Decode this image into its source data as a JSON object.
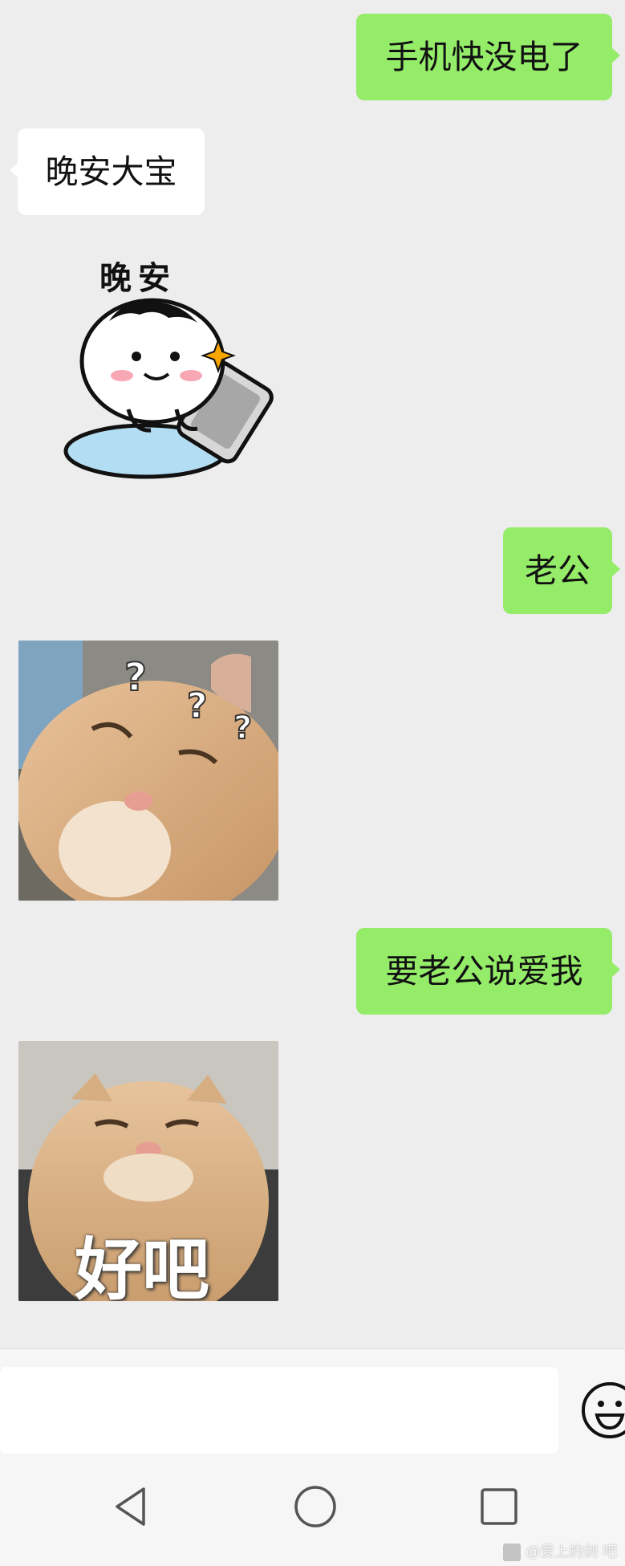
{
  "messages": [
    {
      "direction": "outgoing",
      "type": "text",
      "text": "手机快没电了"
    },
    {
      "direction": "incoming",
      "type": "text",
      "text": "晚安大宝"
    },
    {
      "direction": "incoming",
      "type": "sticker",
      "caption": "晚安"
    },
    {
      "direction": "outgoing",
      "type": "text",
      "text": "老公"
    },
    {
      "direction": "incoming",
      "type": "sticker",
      "caption": "???"
    },
    {
      "direction": "outgoing",
      "type": "text",
      "text": "要老公说爱我"
    },
    {
      "direction": "incoming",
      "type": "sticker",
      "caption": "好吧"
    }
  ],
  "input_bar": {
    "value": "",
    "emoji_icon": "emoji-smile-icon"
  },
  "nav_bar": {
    "back_icon": "triangle-back-icon",
    "home_icon": "circle-home-icon",
    "recents_icon": "square-recents-icon"
  },
  "watermark": {
    "text": "@爱上的剑 吧"
  },
  "colors": {
    "outgoing_bubble": "#95EC69",
    "incoming_bubble": "#FFFFFF",
    "chat_background": "#EDEDED",
    "bar_background": "#F6F6F6"
  }
}
